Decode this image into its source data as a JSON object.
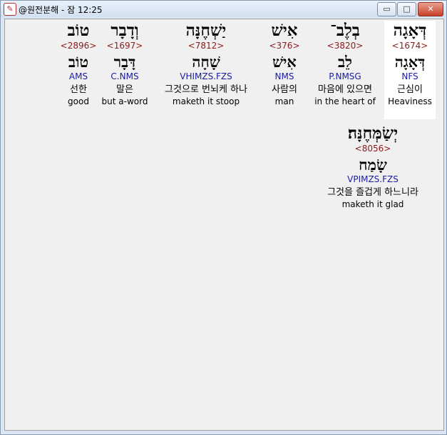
{
  "window": {
    "title": "@원전분해 - 잠 12:25",
    "icon": "verse-app-icon",
    "buttons": {
      "minimize": "▭",
      "maximize": "□",
      "close": "✕"
    }
  },
  "words": [
    {
      "hebrew": "דְּאָגָה",
      "strongs": "<1674>",
      "root": "דְּאָגָה",
      "morph": "NFS",
      "korean": "근심이",
      "english": "Heaviness",
      "highlighted": true
    },
    {
      "hebrew": "בְלֶב־",
      "strongs": "<3820>",
      "root": "לֵב",
      "morph": "P.NMSG",
      "korean": "마음에 있으면",
      "english": "in the heart of",
      "highlighted": false
    },
    {
      "hebrew": "אִישׁ",
      "strongs": "<376>",
      "root": "אִישׁ",
      "morph": "NMS",
      "korean": "사람의",
      "english": "man",
      "highlighted": false
    },
    {
      "hebrew": "יַשְׁחֶנָּה",
      "strongs": "<7812>",
      "root": "שָׁחָה",
      "morph": "VHIMZS.FZS",
      "korean": "그것으로 번뇌케 하나",
      "english": "maketh it stoop",
      "highlighted": false
    },
    {
      "hebrew": "וְדָבָר",
      "strongs": "<1697>",
      "root": "דָּבָר",
      "morph": "C.NMS",
      "korean": "말은",
      "english": "but a-word",
      "highlighted": false
    },
    {
      "hebrew": "טוֹב",
      "strongs": "<2896>",
      "root": "טוֹב",
      "morph": "AMS",
      "korean": "선한",
      "english": "good",
      "highlighted": false
    },
    {
      "hebrew": "יְשַׂמְּחֶנָּה׃",
      "strongs": "<8056>",
      "root": "שָׂמַח",
      "morph": "VPIMZS.FZS",
      "korean": "그것을 즐겁게 하느니라",
      "english": "maketh it glad",
      "highlighted": false
    }
  ]
}
